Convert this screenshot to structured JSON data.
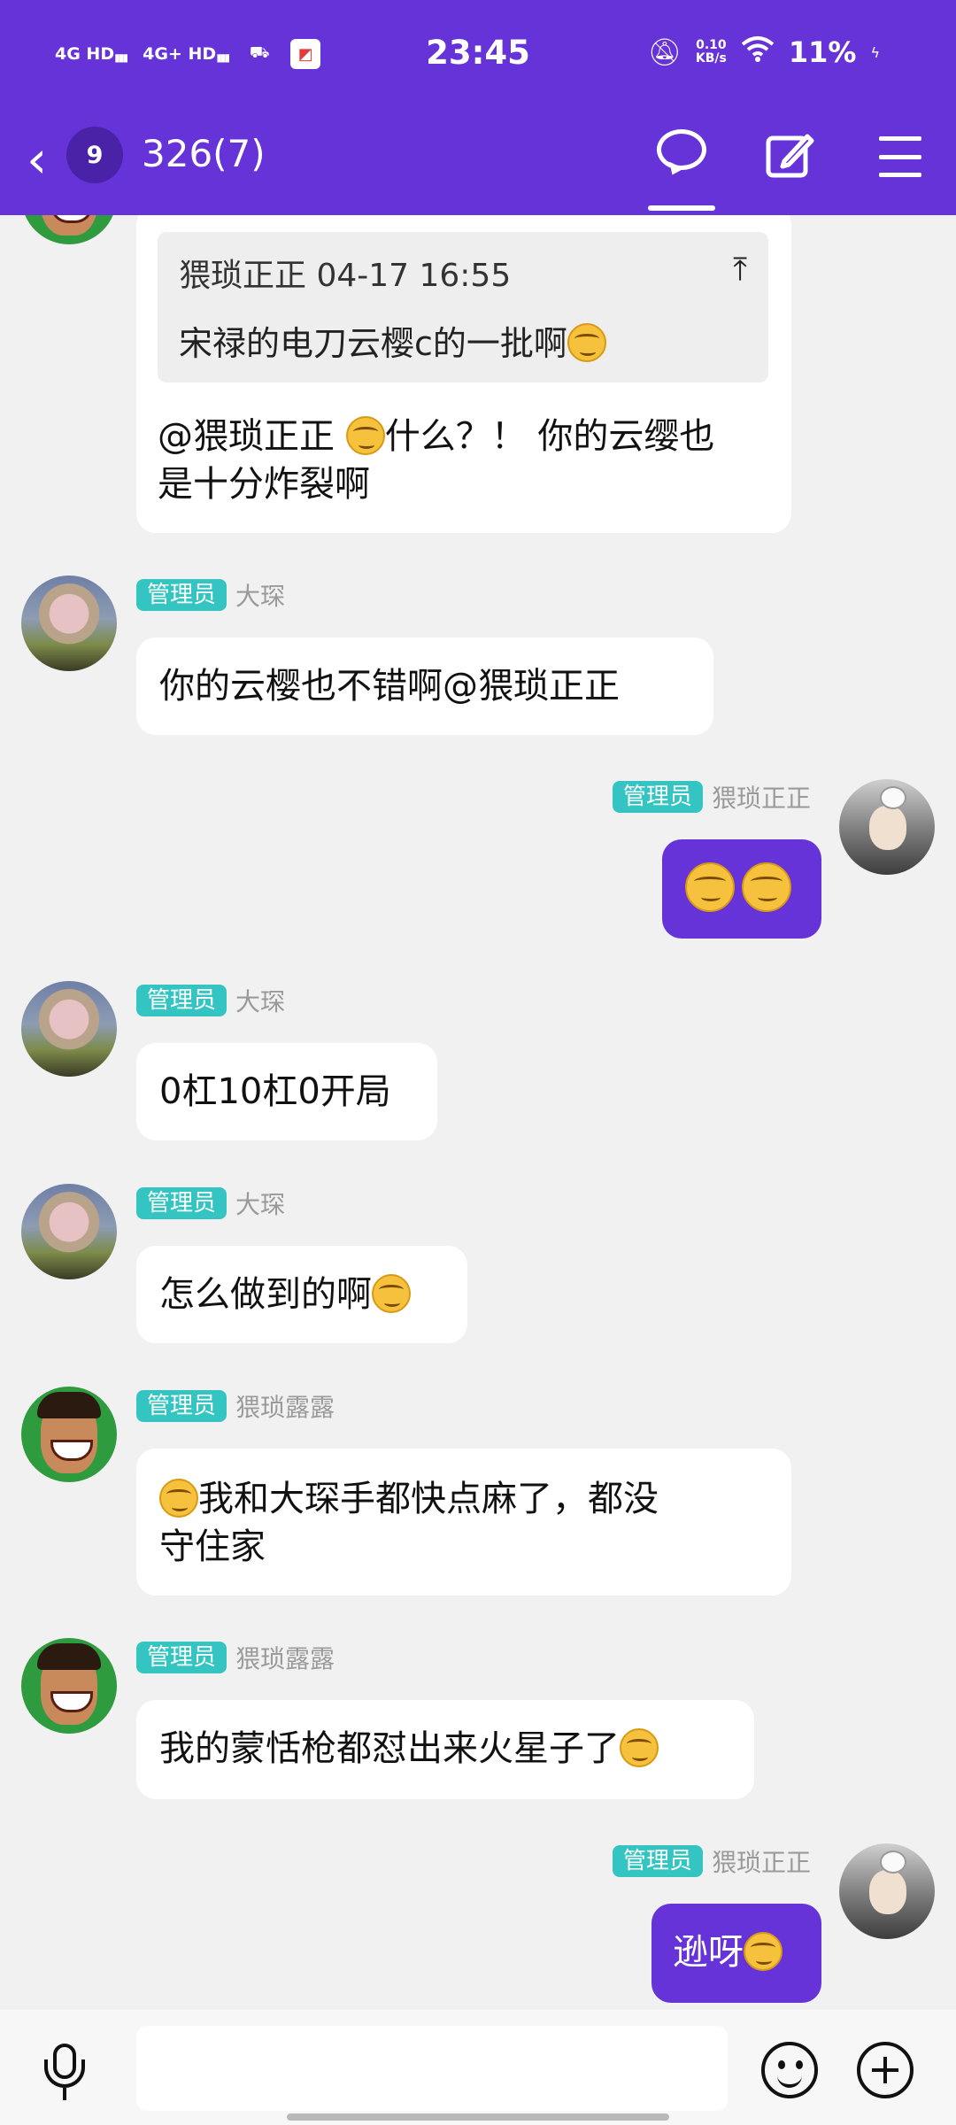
{
  "status_bar": {
    "net1": "4G HD",
    "net2": "4G+ HD",
    "time": "23:45",
    "speed_value": "0.10",
    "speed_unit": "KB/s",
    "battery": "11%"
  },
  "header": {
    "back_count": "9",
    "title": "326(7)"
  },
  "quote": {
    "author_time": "猥琐正正 04-17 16:55",
    "text": "宋禄的电刀云樱c的一批啊"
  },
  "messages": [
    {
      "side": "left",
      "line1": "@猥琐正正 ",
      "line1_after": "什么？！ 你的云缨也",
      "line2": "是十分炸裂啊"
    },
    {
      "side": "left",
      "role": "管理员",
      "name": "大琛",
      "text": "你的云樱也不错啊@猥琐正正"
    },
    {
      "side": "right",
      "role": "管理员",
      "name": "猥琐正正",
      "emojis": 2
    },
    {
      "side": "left",
      "role": "管理员",
      "name": "大琛",
      "text": "0杠10杠0开局"
    },
    {
      "side": "left",
      "role": "管理员",
      "name": "大琛",
      "text": "怎么做到的啊"
    },
    {
      "side": "left",
      "role": "管理员",
      "name": "猥琐露露",
      "line1": "我和大琛手都快点麻了，都没",
      "line2": "守住家"
    },
    {
      "side": "left",
      "role": "管理员",
      "name": "猥琐露露",
      "text": "我的蒙恬枪都怼出来火星子了"
    },
    {
      "side": "right",
      "role": "管理员",
      "name": "猥琐正正",
      "text": "逊呀"
    }
  ],
  "input": {
    "placeholder": ""
  },
  "icons": {
    "back": "chevron-left-icon",
    "chat": "chat-bubble-icon",
    "edit": "edit-icon",
    "menu": "hamburger-menu-icon",
    "emoji": "grinning-squint-emoji",
    "voice": "microphone-icon",
    "sticker": "smiley-icon",
    "more": "plus-circle-icon"
  },
  "colors": {
    "accent": "#6633d9",
    "role_badge": "#34c5c2",
    "background": "#f1f1f1"
  }
}
